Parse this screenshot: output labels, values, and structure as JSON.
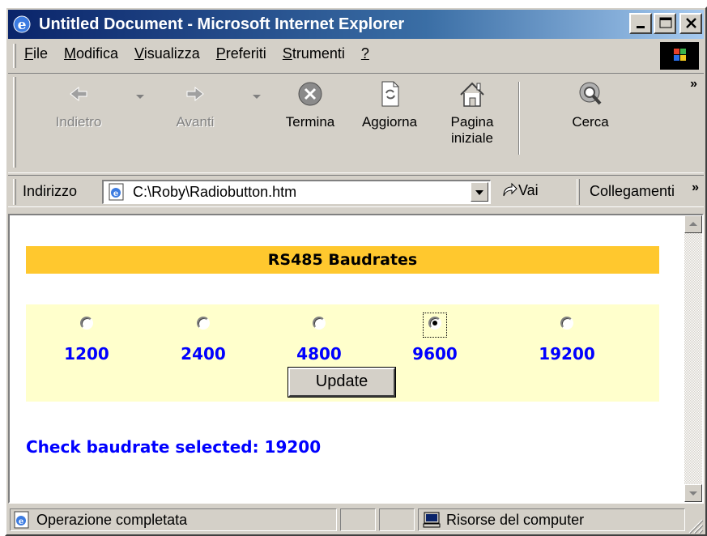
{
  "window": {
    "title": "Untitled Document - Microsoft Internet Explorer"
  },
  "menubar": {
    "items": [
      {
        "label": "File",
        "mnemonic": "F"
      },
      {
        "label": "Modifica",
        "mnemonic": "M"
      },
      {
        "label": "Visualizza",
        "mnemonic": "V"
      },
      {
        "label": "Preferiti",
        "mnemonic": "P"
      },
      {
        "label": "Strumenti",
        "mnemonic": "S"
      },
      {
        "label": "?",
        "mnemonic": "?"
      }
    ]
  },
  "toolbar": {
    "back": "Indietro",
    "forward": "Avanti",
    "stop": "Termina",
    "refresh": "Aggiorna",
    "home_line1": "Pagina",
    "home_line2": "iniziale",
    "search": "Cerca",
    "more": "»"
  },
  "addressbar": {
    "label": "Indirizzo",
    "value": "C:\\Roby\\Radiobutton.htm",
    "go": "Vai",
    "links": "Collegamenti",
    "more": "»"
  },
  "page": {
    "heading": "RS485 Baudrates",
    "radios": [
      {
        "label": "1200",
        "checked": false
      },
      {
        "label": "2400",
        "checked": false
      },
      {
        "label": "4800",
        "checked": false
      },
      {
        "label": "9600",
        "checked": true
      },
      {
        "label": "19200",
        "checked": false
      }
    ],
    "update_button": "Update",
    "check_text": "Check baudrate selected: 19200"
  },
  "statusbar": {
    "status": "Operazione completata",
    "zone": "Risorse del computer"
  },
  "colors": {
    "title_bar": "#0a246a",
    "heading_bar": "#ffc82e",
    "form_panel": "#ffffcc",
    "link_blue": "#0000ff"
  }
}
